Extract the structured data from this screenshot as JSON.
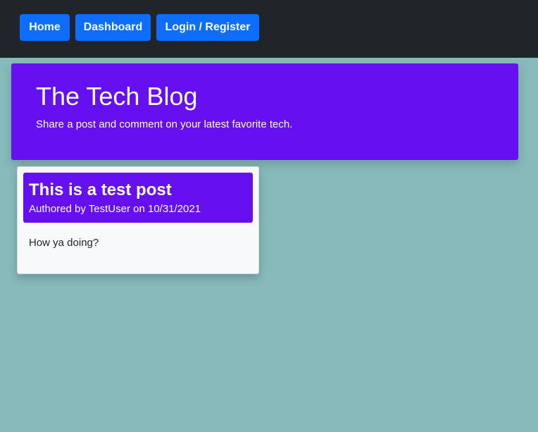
{
  "nav": {
    "home_label": "Home",
    "dashboard_label": "Dashboard",
    "login_label": "Login / Register"
  },
  "hero": {
    "title": "The Tech Blog",
    "subtitle": "Share a post and comment on your latest favorite tech."
  },
  "posts": [
    {
      "title": "This is a test post",
      "meta": "Authored by TestUser on 10/31/2021",
      "body": "How ya doing?"
    }
  ],
  "colors": {
    "page_background": "#88babb",
    "navbar": "#212529",
    "nav_button": "#0d6efd",
    "accent_purple": "#6610f2",
    "card_background": "#f8f9fa"
  }
}
